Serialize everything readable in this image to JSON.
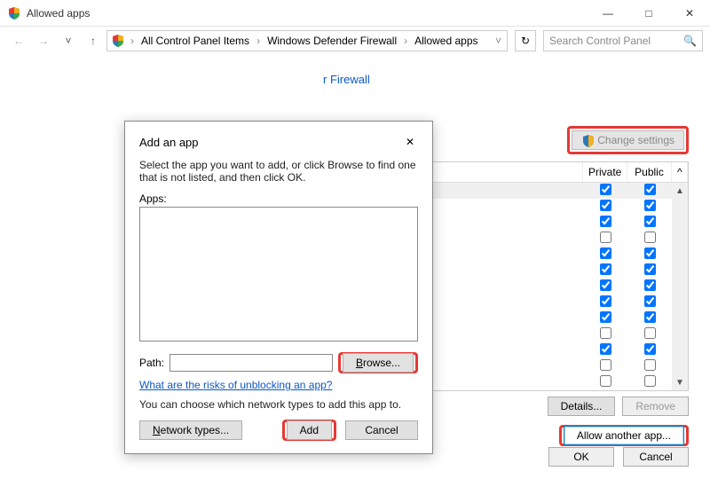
{
  "window": {
    "title": "Allowed apps",
    "controls": {
      "minimize": "—",
      "maximize": "□",
      "close": "✕"
    }
  },
  "nav": {
    "back": "←",
    "forward": "→",
    "up": "↑",
    "refresh": "↻",
    "breadcrumb": [
      "All Control Panel Items",
      "Windows Defender Firewall",
      "Allowed apps"
    ],
    "search_placeholder": "Search Control Panel"
  },
  "page": {
    "heading_fragment": "r Firewall",
    "change_settings": "Change settings",
    "table": {
      "col_private": "Private",
      "col_public": "Public",
      "rows": [
        {
          "private": true,
          "public": true
        },
        {
          "private": true,
          "public": true
        },
        {
          "private": true,
          "public": true
        },
        {
          "private": false,
          "public": false
        },
        {
          "private": true,
          "public": true
        },
        {
          "private": true,
          "public": true
        },
        {
          "private": true,
          "public": true
        },
        {
          "private": true,
          "public": true
        },
        {
          "private": true,
          "public": true
        },
        {
          "private": false,
          "public": false
        },
        {
          "private": true,
          "public": true
        },
        {
          "private": false,
          "public": false
        },
        {
          "private": false,
          "public": false
        }
      ]
    },
    "details": "Details...",
    "remove": "Remove",
    "allow_another": "Allow another app...",
    "ok": "OK",
    "cancel": "Cancel"
  },
  "dialog": {
    "title": "Add an app",
    "instruction": "Select the app you want to add, or click Browse to find one that is not listed, and then click OK.",
    "apps_label": "Apps:",
    "path_label": "Path:",
    "path_value": "",
    "browse": "Browse...",
    "risk_link": "What are the risks of unblocking an app?",
    "choose_net": "You can choose which network types to add this app to.",
    "network_types": "Network types...",
    "add": "Add",
    "cancel": "Cancel"
  }
}
